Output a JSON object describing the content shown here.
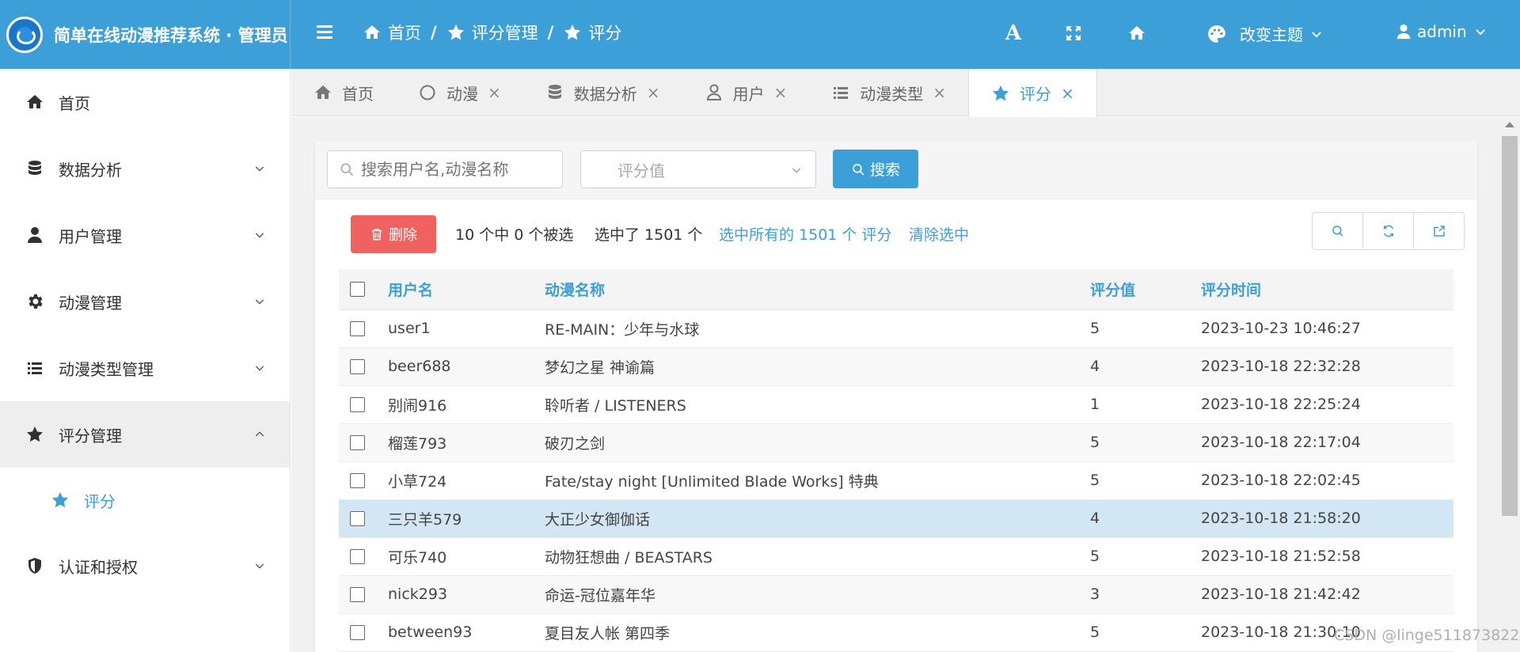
{
  "header": {
    "brand_title": "简单在线动漫推荐系统 · 管理员",
    "breadcrumb": [
      "首页",
      "评分管理",
      "评分"
    ],
    "breadcrumb_sep": "/",
    "theme_label": "改变主题",
    "user_label": "admin",
    "font_icon_text": "A"
  },
  "sidebar": {
    "items": [
      {
        "label": "首页",
        "icon": "home-icon"
      },
      {
        "label": "数据分析",
        "icon": "database-icon"
      },
      {
        "label": "用户管理",
        "icon": "user-icon"
      },
      {
        "label": "动漫管理",
        "icon": "gear-icon"
      },
      {
        "label": "动漫类型管理",
        "icon": "list-icon"
      },
      {
        "label": "评分管理",
        "icon": "star-icon"
      },
      {
        "label": "认证和授权",
        "icon": "shield-icon"
      }
    ],
    "sub_item": {
      "label": "评分",
      "icon": "star-icon"
    }
  },
  "tabs": [
    {
      "label": "首页",
      "icon": "home-icon",
      "closable": false
    },
    {
      "label": "动漫",
      "icon": "circle-icon",
      "closable": true
    },
    {
      "label": "数据分析",
      "icon": "database-icon",
      "closable": true
    },
    {
      "label": "用户",
      "icon": "user-icon",
      "closable": true
    },
    {
      "label": "动漫类型",
      "icon": "list-icon",
      "closable": true
    },
    {
      "label": "评分",
      "icon": "star-icon",
      "closable": true,
      "active": true
    }
  ],
  "tab_close": "×",
  "search": {
    "placeholder": "搜索用户名,动漫名称",
    "select_placeholder": "评分值",
    "button_label": "搜索"
  },
  "toolbar": {
    "delete_label": "删除",
    "selection_status": "10 个中 0 个被选",
    "selected_count": "选中了 1501 个",
    "select_all_link": "选中所有的 1501 个 评分",
    "clear_link": "清除选中"
  },
  "table": {
    "columns": [
      "用户名",
      "动漫名称",
      "评分值",
      "评分时间"
    ],
    "rows": [
      {
        "user": "user1",
        "anime": "RE-MAIN：少年与水球",
        "score": "5",
        "time": "2023-10-23 10:46:27"
      },
      {
        "user": "beer688",
        "anime": "梦幻之星 神谕篇",
        "score": "4",
        "time": "2023-10-18 22:32:28"
      },
      {
        "user": "别闹916",
        "anime": "聆听者 / LISTENERS",
        "score": "1",
        "time": "2023-10-18 22:25:24"
      },
      {
        "user": "榴莲793",
        "anime": "破刃之剑",
        "score": "5",
        "time": "2023-10-18 22:17:04"
      },
      {
        "user": "小草724",
        "anime": "Fate/stay night [Unlimited Blade Works] 特典",
        "score": "5",
        "time": "2023-10-18 22:02:45"
      },
      {
        "user": "三只羊579",
        "anime": "大正少女御伽话",
        "score": "4",
        "time": "2023-10-18 21:58:20"
      },
      {
        "user": "可乐740",
        "anime": "动物狂想曲 / BEASTARS",
        "score": "5",
        "time": "2023-10-18 21:52:58"
      },
      {
        "user": "nick293",
        "anime": "命运-冠位嘉年华",
        "score": "3",
        "time": "2023-10-18 21:42:42"
      },
      {
        "user": "between93",
        "anime": "夏目友人帐 第四季",
        "score": "5",
        "time": "2023-10-18 21:30:10"
      }
    ]
  },
  "watermark": "CSDN @linge511873822",
  "colors": {
    "primary": "#3c9fd8",
    "danger": "#f0625f",
    "highlight_row": "#d3e6f3"
  }
}
